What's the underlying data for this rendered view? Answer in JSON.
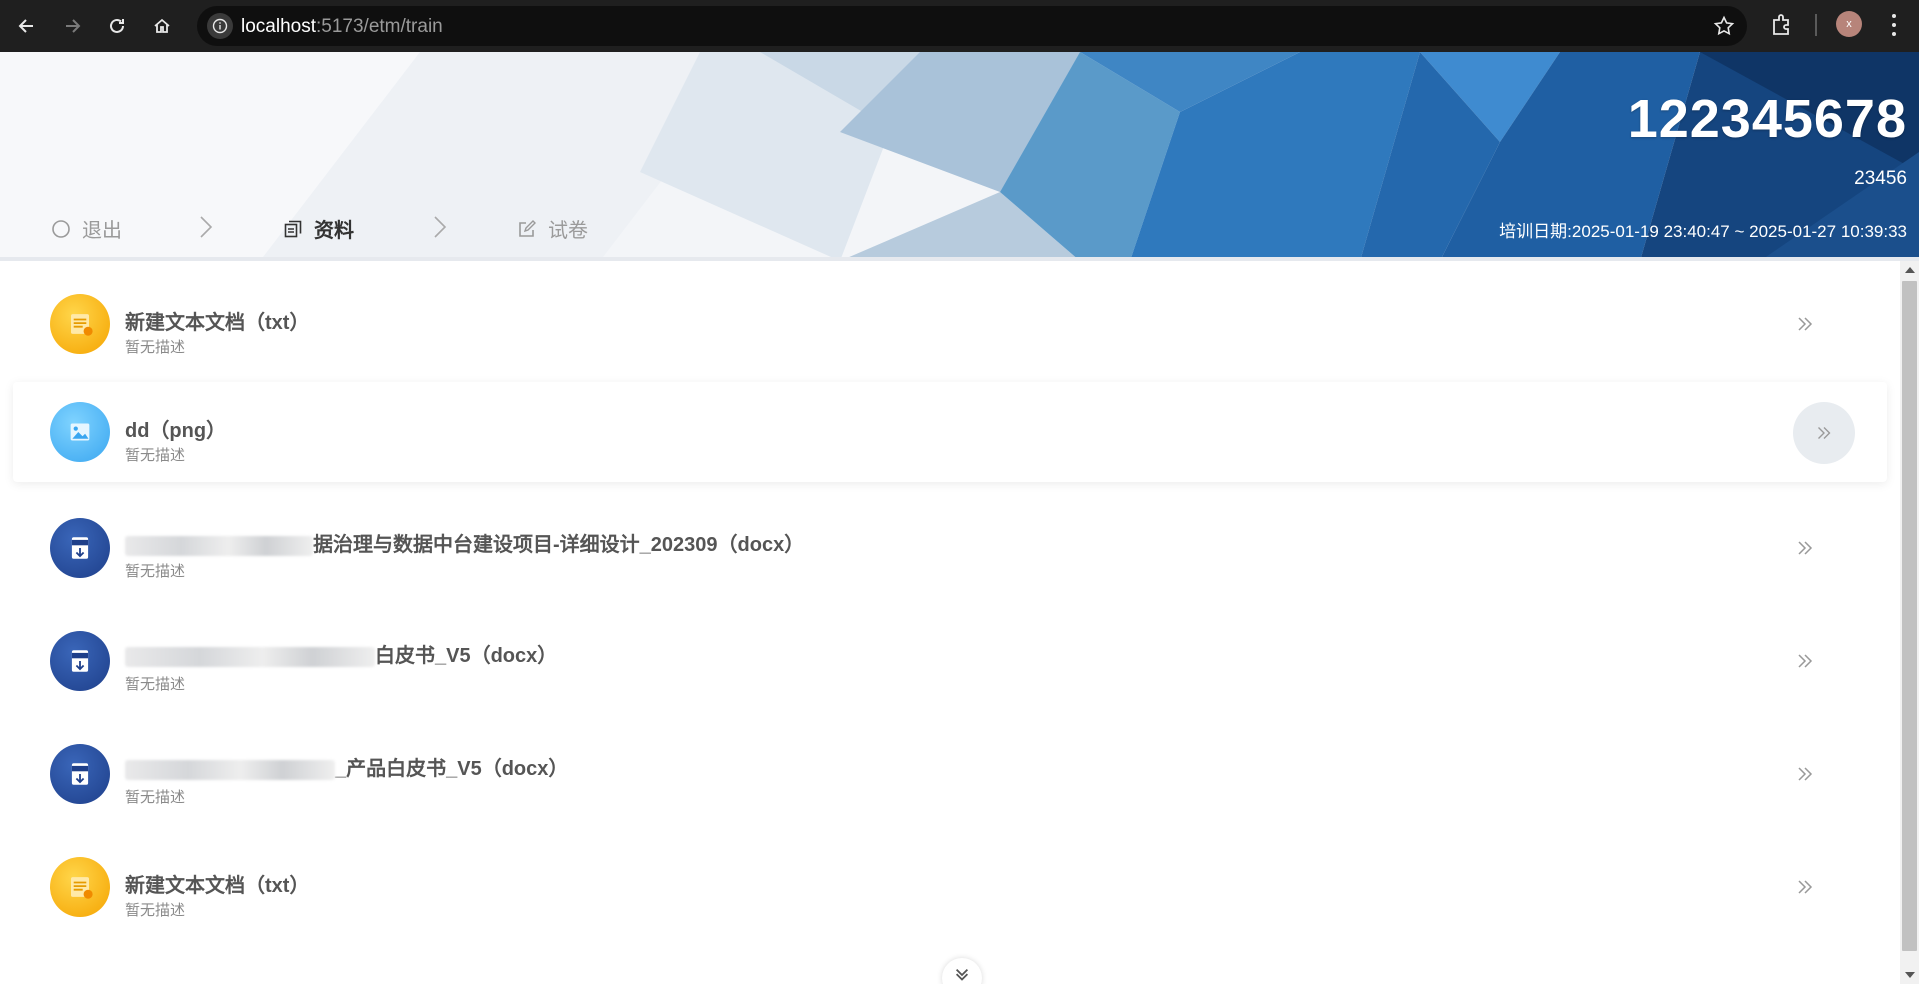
{
  "browser": {
    "url_host": "localhost",
    "url_path": ":5173/etm/train",
    "profile_initial": "x"
  },
  "banner": {
    "title": "122345678",
    "subtitle": "23456",
    "date_label": "培训日期:",
    "date_range": "2025-01-19 23:40:47 ~ 2025-01-27 10:39:33"
  },
  "steps": [
    {
      "label": "退出",
      "icon": "circle-icon"
    },
    {
      "label": "资料",
      "icon": "copy-icon"
    },
    {
      "label": "试卷",
      "icon": "edit-icon"
    }
  ],
  "items": [
    {
      "type": "txt",
      "title": "新建文本文档（txt）",
      "desc": "暂无描述"
    },
    {
      "type": "png",
      "title": "dd（png）",
      "desc": "暂无描述"
    },
    {
      "type": "doc",
      "title_suffix": "据治理与数据中台建设项目-详细设计_202309（docx）",
      "desc": "暂无描述"
    },
    {
      "type": "doc",
      "title_suffix": "白皮书_V5（docx）",
      "desc": "暂无描述"
    },
    {
      "type": "doc",
      "title_suffix": "_产品白皮书_V5（docx）",
      "desc": "暂无描述"
    },
    {
      "type": "txt",
      "title": "新建文本文档（txt）",
      "desc": "暂无描述"
    }
  ],
  "colors": {
    "chrome_bg": "#1f1f1f",
    "banner_blue": "#1f6fb5",
    "doc_icon": "#1e3f8a",
    "txt_icon": "#f5a300",
    "png_icon": "#3aa6f0"
  }
}
